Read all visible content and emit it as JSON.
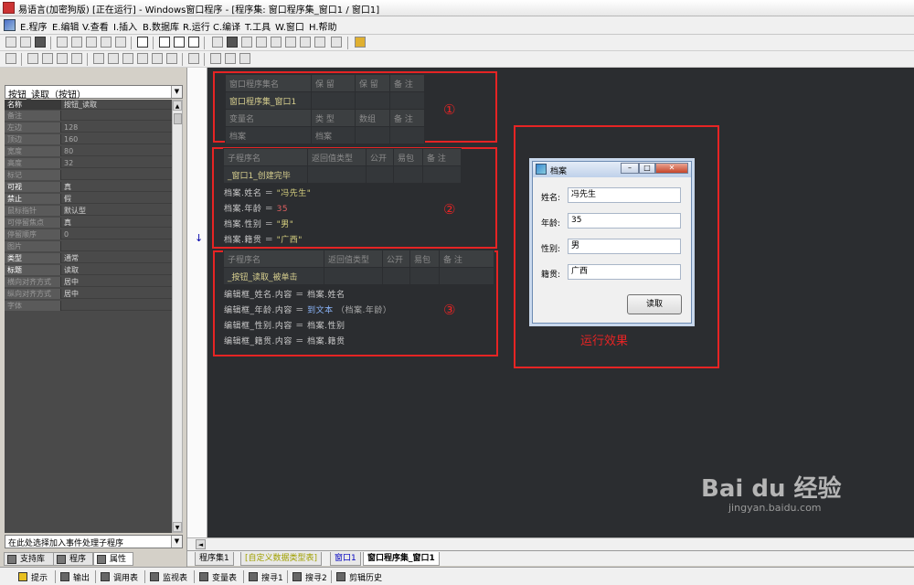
{
  "window": {
    "title": "易语言(加密狗版) [正在运行] - Windows窗口程序 - [程序集: 窗口程序集_窗口1 / 窗口1]"
  },
  "menu": [
    "E.程序",
    "E.编辑",
    "V.查看",
    "I.插入",
    "B.数据库",
    "R.运行",
    "C.编译",
    "T.工具",
    "W.窗口",
    "H.帮助"
  ],
  "object_selector": {
    "value": "按钮_读取（按钮）"
  },
  "properties": [
    {
      "name": "名称",
      "value": "按钮_读取"
    },
    {
      "name": "备注",
      "value": ""
    },
    {
      "name": "左边",
      "value": "128"
    },
    {
      "name": "顶边",
      "value": "160"
    },
    {
      "name": "宽度",
      "value": "80"
    },
    {
      "name": "高度",
      "value": "32"
    },
    {
      "name": "标记",
      "value": ""
    },
    {
      "name": "可视",
      "value": "真"
    },
    {
      "name": "禁止",
      "value": "假"
    },
    {
      "name": "鼠标指针",
      "value": "默认型"
    },
    {
      "name": "可停留焦点",
      "value": "真"
    },
    {
      "name": "停留顺序",
      "value": "0"
    },
    {
      "name": "图片",
      "value": ""
    },
    {
      "name": "类型",
      "value": "通常"
    },
    {
      "name": "标题",
      "value": "读取"
    },
    {
      "name": "横向对齐方式",
      "value": "居中"
    },
    {
      "name": "纵向对齐方式",
      "value": "居中"
    },
    {
      "name": "字体",
      "value": ""
    }
  ],
  "event_selector": {
    "value": "在此处选择加入事件处理子程序"
  },
  "left_tabs": [
    "支持库",
    "程序",
    "属性"
  ],
  "section1": {
    "header1": [
      "窗口程序集名",
      "保 留",
      "保 留",
      "备 注"
    ],
    "row1": [
      "窗口程序集_窗口1",
      "",
      "",
      ""
    ],
    "header2": [
      "变量名",
      "类 型",
      "数组",
      "备 注"
    ],
    "row2": [
      "档案",
      "档案",
      "",
      ""
    ],
    "marker": "①"
  },
  "section2": {
    "header": [
      "子程序名",
      "返回值类型",
      "公开",
      "易包",
      "备 注"
    ],
    "row": [
      "_窗口1_创建完毕",
      "",
      "",
      "",
      ""
    ],
    "code": [
      {
        "obj": "档案.姓名",
        "op": "＝",
        "val": "\"冯先生\"",
        "kind": "str"
      },
      {
        "obj": "档案.年龄",
        "op": "＝",
        "val": "35",
        "kind": "num"
      },
      {
        "obj": "档案.性别",
        "op": "＝",
        "val": "\"男\"",
        "kind": "str"
      },
      {
        "obj": "档案.籍贯",
        "op": "＝",
        "val": "\"广西\"",
        "kind": "str"
      }
    ],
    "marker": "②"
  },
  "section3": {
    "header": [
      "子程序名",
      "返回值类型",
      "公开",
      "易包",
      "备 注"
    ],
    "row": [
      "_按钮_读取_被单击",
      "",
      "",
      "",
      ""
    ],
    "code": [
      {
        "lhs": "编辑框_姓名.内容",
        "op": "＝",
        "fn": "",
        "rhs": "档案.姓名"
      },
      {
        "lhs": "编辑框_年龄.内容",
        "op": "＝",
        "fn": "到文本",
        "rhs": "（档案.年龄）"
      },
      {
        "lhs": "编辑框_性别.内容",
        "op": "＝",
        "fn": "",
        "rhs": "档案.性别"
      },
      {
        "lhs": "编辑框_籍贯.内容",
        "op": "＝",
        "fn": "",
        "rhs": "档案.籍贯"
      }
    ],
    "marker": "③"
  },
  "preview": {
    "title": "档案",
    "fields": [
      {
        "label": "姓名:",
        "value": "冯先生"
      },
      {
        "label": "年龄:",
        "value": "35"
      },
      {
        "label": "性别:",
        "value": "男"
      },
      {
        "label": "籍贯:",
        "value": "广西"
      }
    ],
    "button": "读取",
    "caption": "运行效果"
  },
  "editor_tabs": [
    "程序集1",
    "[自定义数据类型表]",
    "窗口1",
    "窗口程序集_窗口1"
  ],
  "bottom_bar": [
    "提示",
    "输出",
    "调用表",
    "监视表",
    "变量表",
    "搜寻1",
    "搜寻2",
    "剪辑历史"
  ],
  "watermark": {
    "text": "Bai du 经验",
    "sub": "jingyan.baidu.com"
  },
  "colors": {
    "editor_bg": "#2b2d30",
    "annotation_red": "#e62424",
    "string_color": "#d7d17f"
  }
}
